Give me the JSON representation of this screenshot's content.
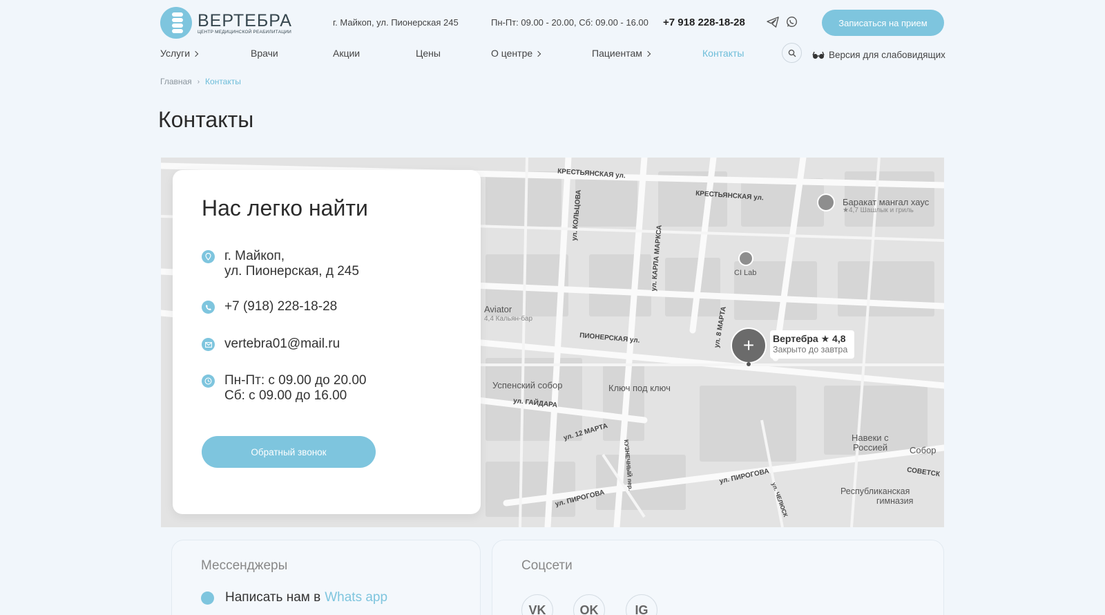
{
  "header": {
    "logo_title": "ВЕРТЕБРА",
    "logo_subtitle": "ЦЕНТР МЕДИЦИНСКОЙ РЕАБИЛИТАЦИИ",
    "address": "г. Майкоп, ул. Пионерская 245",
    "hours": "Пн-Пт: 09.00 - 20.00, Сб: 09.00 - 16.00",
    "phone": "+7 918 228-18-28",
    "book_button": "Записаться на прием",
    "telegram_icon": "telegram-icon",
    "whatsapp_icon": "whatsapp-icon"
  },
  "nav": {
    "services": "Услуги",
    "doctors": "Врачи",
    "promos": "Акции",
    "prices": "Цены",
    "about": "О центре",
    "patients": "Пациентам",
    "contacts": "Контакты",
    "visually_impaired": "Версия для слабовидящих"
  },
  "breadcrumbs": {
    "home": "Главная",
    "current": "Контакты"
  },
  "page_title": "Контакты",
  "contact_card": {
    "title": "Нас легко найти",
    "address_line1": "г. Майкоп,",
    "address_line2": "ул. Пионерская, д 245",
    "phone": "+7 (918) 228-18-28",
    "email": "vertebra01@mail.ru",
    "hours_line1": "Пн-Пт: с 09.00 до 20.00",
    "hours_line2": "Сб: с 09.00 до 16.00",
    "callback_button": "Обратный звонок"
  },
  "map": {
    "place_name": "Вертебра",
    "rating": "★ 4,8",
    "status": "Закрыто до завтра",
    "streets": {
      "krest1": "КРЕСТЬЯНСКАЯ ул.",
      "krest2": "КРЕСТЬЯНСКАЯ ул.",
      "pioner": "ПИОНЕРСКАЯ ул.",
      "gaidara": "ул. ГАЙДАРА",
      "mart12": "ул. 12 МАРТА",
      "pirogova1": "ул. ПИРОГОВА",
      "pirogova2": "ул. ПИРОГОВА",
      "koltsova": "ул. КОЛЬЦОВА",
      "marksa": "ул. КАРЛА МАРКСА",
      "mart8": "ул. 8 МАРТА",
      "sovetsk": "СОВЕТСК",
      "kuznech": "КУЗНЕЧНЫЙ пер.",
      "chelyusk": "ул. ЧЕЛЮСК"
    },
    "poi": {
      "barakat": "Баракат мангал хаус",
      "barakat_sub": "★4,7 Шашлык и гриль",
      "cilab": "CI Lab",
      "aviator": "Aviator",
      "aviator_sub": "4,4 Кальян-бар",
      "sobor": "Успенский собор",
      "kluch": "Ключ под ключ",
      "naveki": "Навеки с",
      "naveki2": "Россией",
      "sobor_r": "Собор",
      "gymn": "Республиканская",
      "gymn2": "гимназия"
    }
  },
  "messengers": {
    "title": "Мессенджеры",
    "prefix": "Написать нам в",
    "link": "Whats app"
  },
  "socials": {
    "title": "Соцсети",
    "vk": "VK",
    "ok": "OK",
    "ig": "IG"
  }
}
